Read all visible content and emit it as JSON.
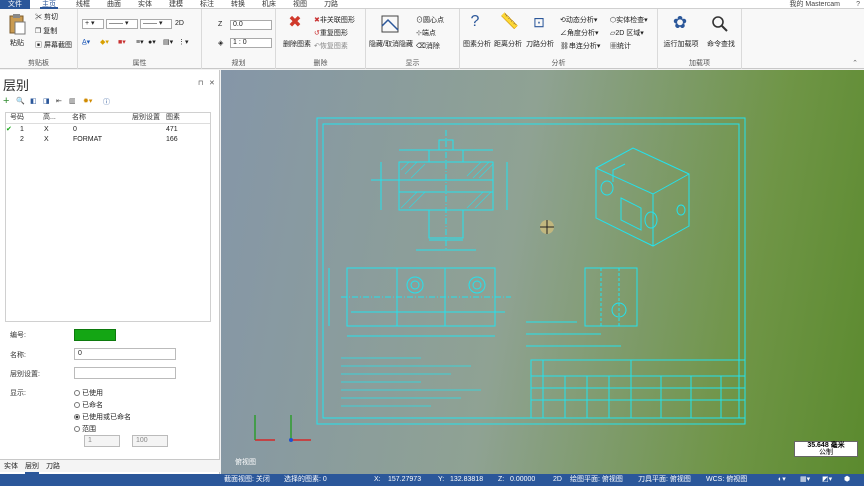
{
  "tabs": [
    "文件",
    "主页",
    "线框",
    "曲面",
    "实体",
    "建模",
    "标注",
    "转换",
    "机床",
    "视图",
    "刀路"
  ],
  "user": "我的 Mastercam",
  "ribbon": {
    "clipboard": {
      "paste": "粘贴",
      "cut": "剪切",
      "copy": "复制",
      "screenshot": "屏幕截图",
      "label": "剪贴板"
    },
    "attributes": {
      "twod": "2D",
      "label": "属性"
    },
    "plan": {
      "z_label": "Z",
      "z_value": "0.0",
      "scale_value": "1 : 0",
      "label": "规划"
    },
    "delete": {
      "delete_entity": "删除图素",
      "unassoc": "非关联图形",
      "redo": "重复图形",
      "restore": "恢复图素",
      "label": "删除"
    },
    "display": {
      "hide": "隐藏/取消隐藏",
      "center": "圆心点",
      "endpoint": "端点",
      "erase": "消除",
      "label": "显示"
    },
    "analysis": {
      "entity": "图素分析",
      "distance": "距离分析",
      "toolpath": "刀路分析",
      "dynamic": "动态分析",
      "angle": "角度分析",
      "chain": "串连分析",
      "solid_check": "实体检查",
      "area": "2D 区域",
      "stats": "统计",
      "label": "分析"
    },
    "addins": {
      "run": "运行加载项",
      "cmd_find": "命令查找",
      "label": "加载项"
    }
  },
  "panel": {
    "title": "层别",
    "columns": [
      "号码",
      "高...",
      "名称",
      "层别设置",
      "图素"
    ],
    "rows": [
      {
        "num": "1",
        "vis": "X",
        "name": "0",
        "setting": "",
        "count": "471"
      },
      {
        "num": "2",
        "vis": "X",
        "name": "FORMAT",
        "setting": "",
        "count": "166"
      }
    ],
    "fields": {
      "number_label": "编号:",
      "name_label": "名称:",
      "name_value": "0",
      "setting_label": "层别设置:",
      "display_label": "显示:",
      "opt_used": "已使用",
      "opt_named": "已命名",
      "opt_used_or_named": "已使用或已命名",
      "opt_range": "范围",
      "range_from": "1",
      "range_to": "100"
    },
    "bottom_tabs": [
      "实体",
      "层别",
      "刀路"
    ]
  },
  "canvas": {
    "view_label": "俯视图",
    "scale_value": "35.648 毫米",
    "scale_unit": "公制"
  },
  "status": {
    "section_view": "截面视图: 关闭",
    "selected": "选择的图素: 0",
    "x_label": "X:",
    "x_value": "157.27973",
    "y_label": "Y:",
    "y_value": "132.83818",
    "z_label": "Z:",
    "z_value": "0.00000",
    "mode": "2D",
    "draw_plane": "绘图平面: 俯视图",
    "tool_plane": "刀具平面: 俯视图",
    "wcs": "WCS: 俯视图"
  },
  "colors": {
    "accent": "#2b579a",
    "drawing": "#22e3ee",
    "layer_green": "#14a614"
  }
}
